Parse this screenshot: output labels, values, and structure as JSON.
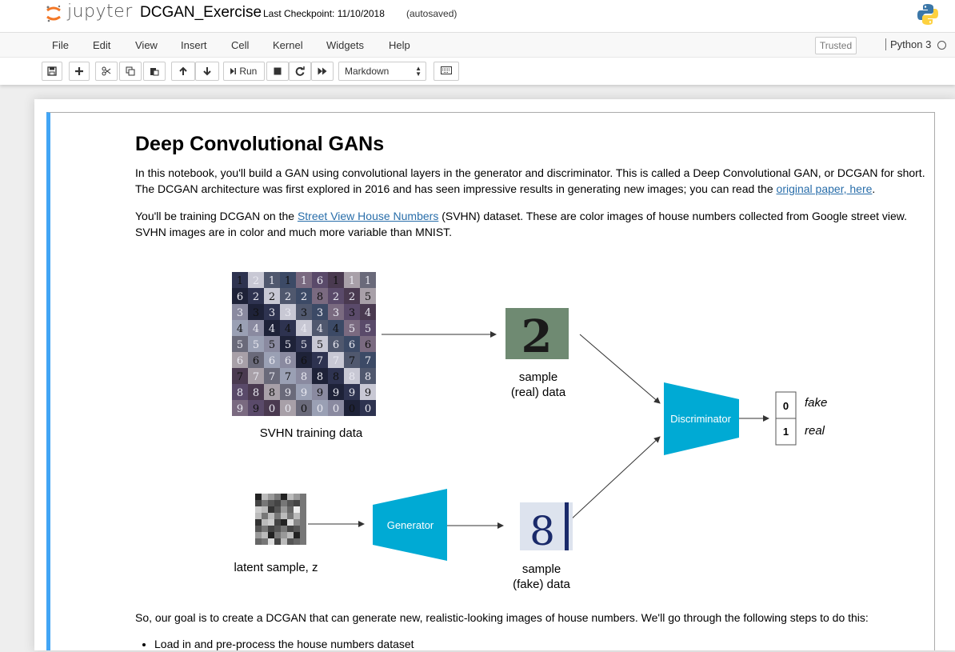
{
  "header": {
    "logo_text": "jupyter",
    "notebook_name": "DCGAN_Exercise",
    "checkpoint": "Last Checkpoint: 11/10/2018",
    "autosave": "(autosaved)"
  },
  "menu": {
    "items": [
      "File",
      "Edit",
      "View",
      "Insert",
      "Cell",
      "Kernel",
      "Widgets",
      "Help"
    ],
    "trusted": "Trusted",
    "kernel": "Python 3"
  },
  "toolbar": {
    "run_label": "Run",
    "cell_type": "Markdown"
  },
  "cell": {
    "heading": "Deep Convolutional GANs",
    "p1_text": "In this notebook, you'll build a GAN using convolutional layers in the generator and discriminator. This is called a Deep Convolutional GAN, or DCGAN for short. The DCGAN architecture was first explored in 2016 and has seen impressive results in generating new images; you can read the ",
    "p1_link": "original paper, here",
    "p1_end": ".",
    "p2_start": "You'll be training DCGAN on the ",
    "p2_link": "Street View House Numbers",
    "p2_rest": " (SVHN) dataset. These are color images of house numbers collected from Google street view. SVHN images are in color and much more variable than MNIST.",
    "p3": "So, our goal is to create a DCGAN that can generate new, realistic-looking images of house numbers. We'll go through the following steps to do this:",
    "bullets": [
      "Load in and pre-process the house numbers dataset"
    ]
  },
  "figure": {
    "svhn_label": "SVHN training data",
    "real_label_1": "sample",
    "real_label_2": "(real) data",
    "real_digit": "2",
    "discriminator": "Discriminator",
    "out_0": "0",
    "out_1": "1",
    "fake_word": "fake",
    "real_word": "real",
    "latent_label": "latent sample, z",
    "generator": "Generator",
    "fake_label_1": "sample",
    "fake_label_2": "(fake) data",
    "fake_digit": "8",
    "grid_digits": [
      "1",
      "2",
      "1",
      "1",
      "1",
      "6",
      "1",
      "1",
      "1",
      "6",
      "2",
      "2",
      "2",
      "2",
      "8",
      "2",
      "2",
      "5",
      "3",
      "3",
      "3",
      "3",
      "3",
      "3",
      "3",
      "3",
      "4",
      "4",
      "4",
      "4",
      "4",
      "4",
      "4",
      "4",
      "5",
      "5",
      "5",
      "5",
      "5",
      "5",
      "5",
      "5",
      "6",
      "6",
      "6",
      "6",
      "6",
      "6",
      "6",
      "6",
      "7",
      "7",
      "7",
      "7",
      "7",
      "7",
      "7",
      "7",
      "8",
      "8",
      "8",
      "8",
      "8",
      "8",
      "8",
      "8",
      "9",
      "9",
      "9",
      "9",
      "9",
      "9",
      "9",
      "9",
      "0",
      "0",
      "0",
      "0",
      "0",
      "0",
      "0",
      "0"
    ]
  },
  "colors": {
    "accent": "#42a5f5",
    "trapezoid": "#00aad4",
    "link": "#296eaa"
  }
}
